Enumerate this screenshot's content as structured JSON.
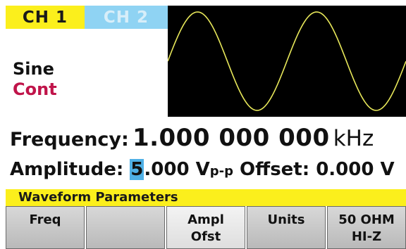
{
  "tabs": [
    {
      "label": "CH 1",
      "active": true
    },
    {
      "label": "CH 2",
      "active": false
    }
  ],
  "colors": {
    "accent": "#fbef1c",
    "tab2": "#8fd3f3",
    "waveform": "#e8e85a",
    "mode": "#c0144a",
    "cursor": "#4fb0e6"
  },
  "display": {
    "shape": "Sine",
    "mode": "Cont",
    "frequency": {
      "label": "Frequency:",
      "value": "1.000 000 000",
      "unit": "kHz"
    },
    "amplitude": {
      "label": "Amplitude:",
      "cursor_digit": "5",
      "rest": ".000 V",
      "unit_sub": "p-p"
    },
    "offset": {
      "label": "Offset:",
      "value": "0.000 V"
    }
  },
  "menu_title": "Waveform Parameters",
  "softkeys": [
    {
      "line1": "Freq",
      "line2": ""
    },
    {
      "line1": "",
      "line2": ""
    },
    {
      "line1": "Ampl",
      "line2": "Ofst"
    },
    {
      "line1": "Units",
      "line2": ""
    },
    {
      "line1": "50 OHM",
      "line2": "HI-Z"
    }
  ]
}
